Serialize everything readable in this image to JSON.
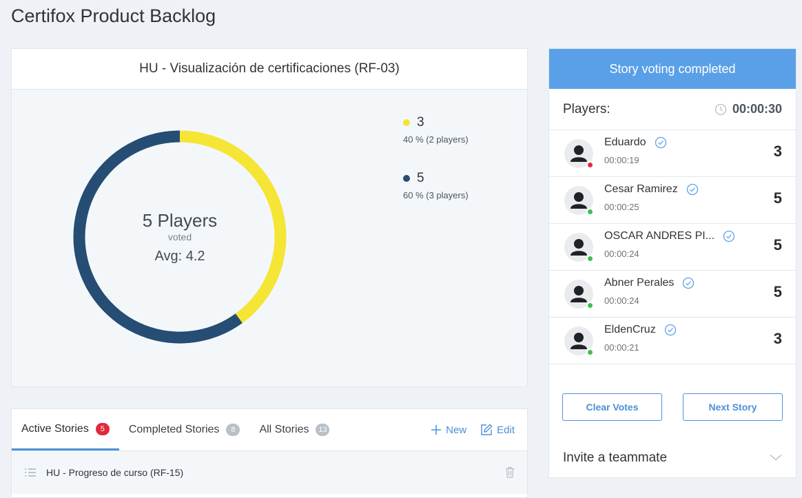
{
  "page": {
    "title": "Certifox Product Backlog"
  },
  "story": {
    "title": "HU - Visualización de certificaciones (RF-03)",
    "summary": {
      "players": "5 Players",
      "voted": "voted",
      "avg": "Avg: 4.2"
    },
    "results": [
      {
        "value": "3",
        "detail": "40 % (2 players)",
        "fraction": 0.4,
        "color": "#f5e534"
      },
      {
        "value": "5",
        "detail": "60 % (3 players)",
        "fraction": 0.6,
        "color": "#264d73"
      }
    ]
  },
  "stories": {
    "tabs": [
      {
        "label": "Active Stories",
        "count": "5"
      },
      {
        "label": "Completed Stories",
        "count": "8"
      },
      {
        "label": "All Stories",
        "count": "13"
      }
    ],
    "actions": {
      "new": "New",
      "edit": "Edit"
    },
    "rows": [
      {
        "title": "HU - Progreso de curso (RF-15)"
      }
    ]
  },
  "voting": {
    "status": "Story voting completed",
    "players_label": "Players:",
    "timer": "00:00:30",
    "players": [
      {
        "name": "Eduardo",
        "time": "00:00:19",
        "vote": "3",
        "status_color": "#e2283b"
      },
      {
        "name": "Cesar Ramirez",
        "time": "00:00:25",
        "vote": "5",
        "status_color": "#3fbf4e"
      },
      {
        "name": "OSCAR ANDRES PI...",
        "time": "00:00:24",
        "vote": "5",
        "status_color": "#3fbf4e"
      },
      {
        "name": "Abner Perales",
        "time": "00:00:24",
        "vote": "5",
        "status_color": "#3fbf4e"
      },
      {
        "name": "EldenCruz",
        "time": "00:00:21",
        "vote": "3",
        "status_color": "#3fbf4e"
      }
    ],
    "buttons": {
      "clear": "Clear Votes",
      "next": "Next Story"
    },
    "invite": "Invite a teammate"
  }
}
